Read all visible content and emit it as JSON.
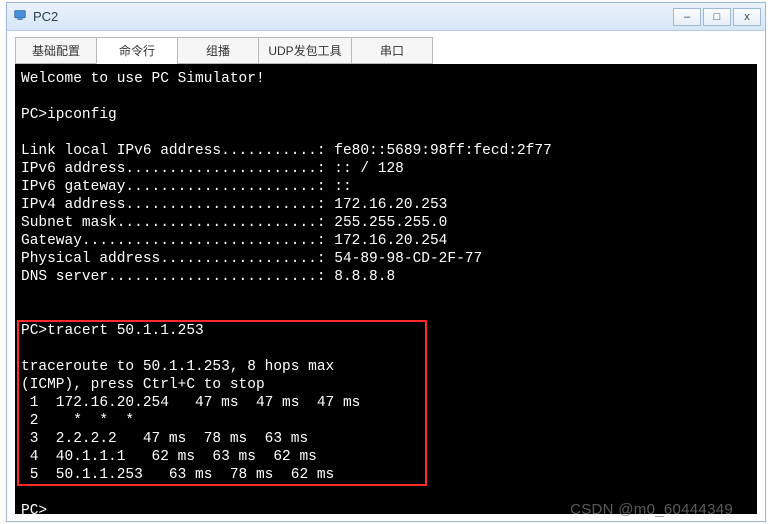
{
  "window": {
    "title": "PC2"
  },
  "tabs": [
    {
      "label": "基础配置"
    },
    {
      "label": "命令行"
    },
    {
      "label": "组播"
    },
    {
      "label": "UDP发包工具"
    },
    {
      "label": "串口"
    }
  ],
  "terminal": {
    "welcome": "Welcome to use PC Simulator!",
    "prompt1": "PC>ipconfig",
    "cfg": {
      "l1": "Link local IPv6 address...........: fe80::5689:98ff:fecd:2f77",
      "l2": "IPv6 address......................: :: / 128",
      "l3": "IPv6 gateway......................: ::",
      "l4": "IPv4 address......................: 172.16.20.253",
      "l5": "Subnet mask.......................: 255.255.255.0",
      "l6": "Gateway...........................: 172.16.20.254",
      "l7": "Physical address..................: 54-89-98-CD-2F-77",
      "l8": "DNS server........................: 8.8.8.8"
    },
    "prompt2": "PC>tracert 50.1.1.253",
    "trace": {
      "h1": "traceroute to 50.1.1.253, 8 hops max",
      "h2": "(ICMP), press Ctrl+C to stop",
      "r1": " 1  172.16.20.254   47 ms  47 ms  47 ms",
      "r2": " 2    *  *  *",
      "r3": " 3  2.2.2.2   47 ms  78 ms  63 ms",
      "r4": " 4  40.1.1.1   62 ms  63 ms  62 ms",
      "r5": " 5  50.1.1.253   63 ms  78 ms  62 ms"
    },
    "prompt3": "PC>"
  },
  "watermark": "CSDN @m0_60444349"
}
